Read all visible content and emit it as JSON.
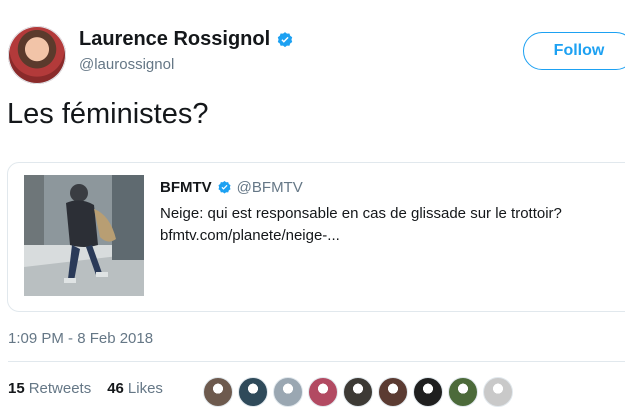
{
  "author": {
    "display_name": "Laurence Rossignol",
    "handle": "@laurossignol",
    "verified_icon": "verified-badge-icon"
  },
  "follow_label": "Follow",
  "tweet_text": "Les féministes?",
  "quoted": {
    "name": "BFMTV",
    "handle": "@BFMTV",
    "text": "Neige: qui est responsable en cas de glissade sur le trottoir?",
    "link": "bfmtv.com/planete/neige-..."
  },
  "timestamp": "1:09 PM - 8 Feb 2018",
  "stats": {
    "retweets_count": "15",
    "retweets_label": "Retweets",
    "likes_count": "46",
    "likes_label": "Likes"
  },
  "likers": [
    {
      "color": "#6d5a4e"
    },
    {
      "color": "#2f4a5a"
    },
    {
      "color": "#9aa7b2"
    },
    {
      "color": "#b24a62"
    },
    {
      "color": "#3d3a35"
    },
    {
      "color": "#5b3b32"
    },
    {
      "color": "#1f1f1f"
    },
    {
      "color": "#4c6a3a"
    },
    {
      "color": "#c9c9c9"
    }
  ],
  "colors": {
    "accent": "#1da1f2",
    "text": "#14171a",
    "secondary": "#657786",
    "border": "#e1e8ed"
  }
}
